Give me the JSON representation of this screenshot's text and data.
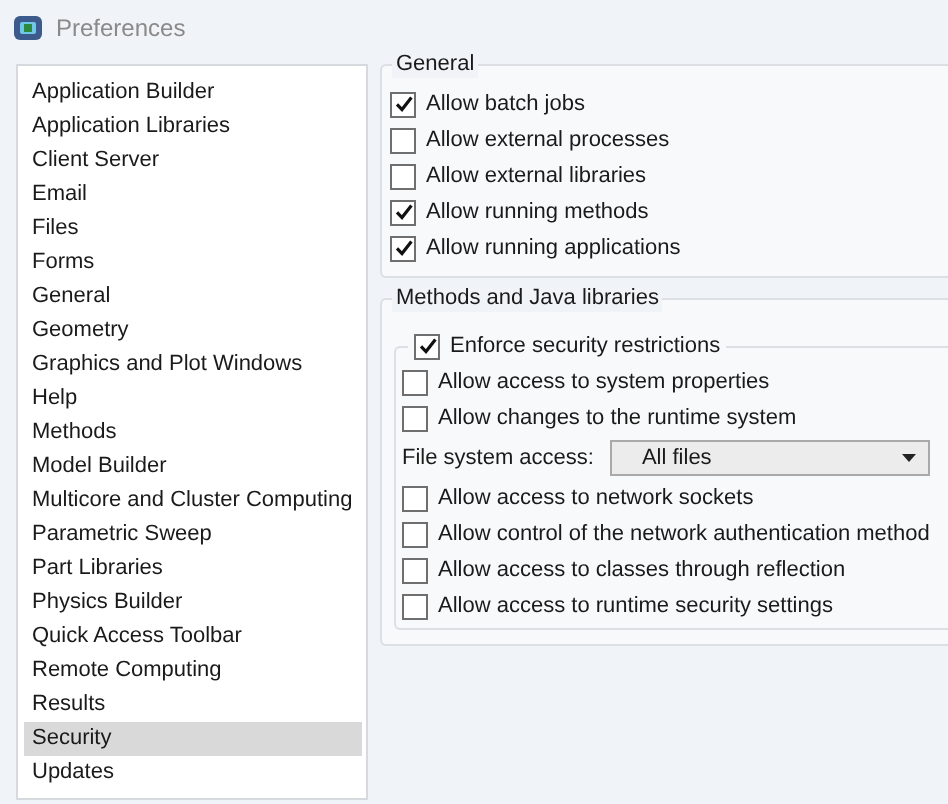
{
  "window": {
    "title": "Preferences"
  },
  "sidebar": {
    "items": [
      {
        "label": "Application Builder",
        "selected": false
      },
      {
        "label": "Application Libraries",
        "selected": false
      },
      {
        "label": "Client Server",
        "selected": false
      },
      {
        "label": "Email",
        "selected": false
      },
      {
        "label": "Files",
        "selected": false
      },
      {
        "label": "Forms",
        "selected": false
      },
      {
        "label": "General",
        "selected": false
      },
      {
        "label": "Geometry",
        "selected": false
      },
      {
        "label": "Graphics and Plot Windows",
        "selected": false
      },
      {
        "label": "Help",
        "selected": false
      },
      {
        "label": "Methods",
        "selected": false
      },
      {
        "label": "Model Builder",
        "selected": false
      },
      {
        "label": "Multicore and Cluster Computing",
        "selected": false
      },
      {
        "label": "Parametric Sweep",
        "selected": false
      },
      {
        "label": "Part Libraries",
        "selected": false
      },
      {
        "label": "Physics Builder",
        "selected": false
      },
      {
        "label": "Quick Access Toolbar",
        "selected": false
      },
      {
        "label": "Remote Computing",
        "selected": false
      },
      {
        "label": "Results",
        "selected": false
      },
      {
        "label": "Security",
        "selected": true
      },
      {
        "label": "Updates",
        "selected": false
      }
    ]
  },
  "general": {
    "title": "General",
    "options": [
      {
        "label": "Allow batch jobs",
        "checked": true
      },
      {
        "label": "Allow external processes",
        "checked": false
      },
      {
        "label": "Allow external libraries",
        "checked": false
      },
      {
        "label": "Allow running methods",
        "checked": true
      },
      {
        "label": "Allow running applications",
        "checked": true
      }
    ]
  },
  "methods": {
    "title": "Methods and Java libraries",
    "enforce": {
      "label": "Enforce security restrictions",
      "checked": true
    },
    "rows": [
      {
        "kind": "checkbox",
        "label": "Allow access to system properties",
        "checked": false
      },
      {
        "kind": "checkbox",
        "label": "Allow changes to the runtime system",
        "checked": false
      },
      {
        "kind": "dropdown",
        "label": "File system access:",
        "value": "All files"
      },
      {
        "kind": "checkbox",
        "label": "Allow access to network sockets",
        "checked": false
      },
      {
        "kind": "checkbox",
        "label": "Allow control of the network authentication method",
        "checked": false
      },
      {
        "kind": "checkbox",
        "label": "Allow access to classes through reflection",
        "checked": false
      },
      {
        "kind": "checkbox",
        "label": "Allow access to runtime security settings",
        "checked": false
      }
    ]
  }
}
